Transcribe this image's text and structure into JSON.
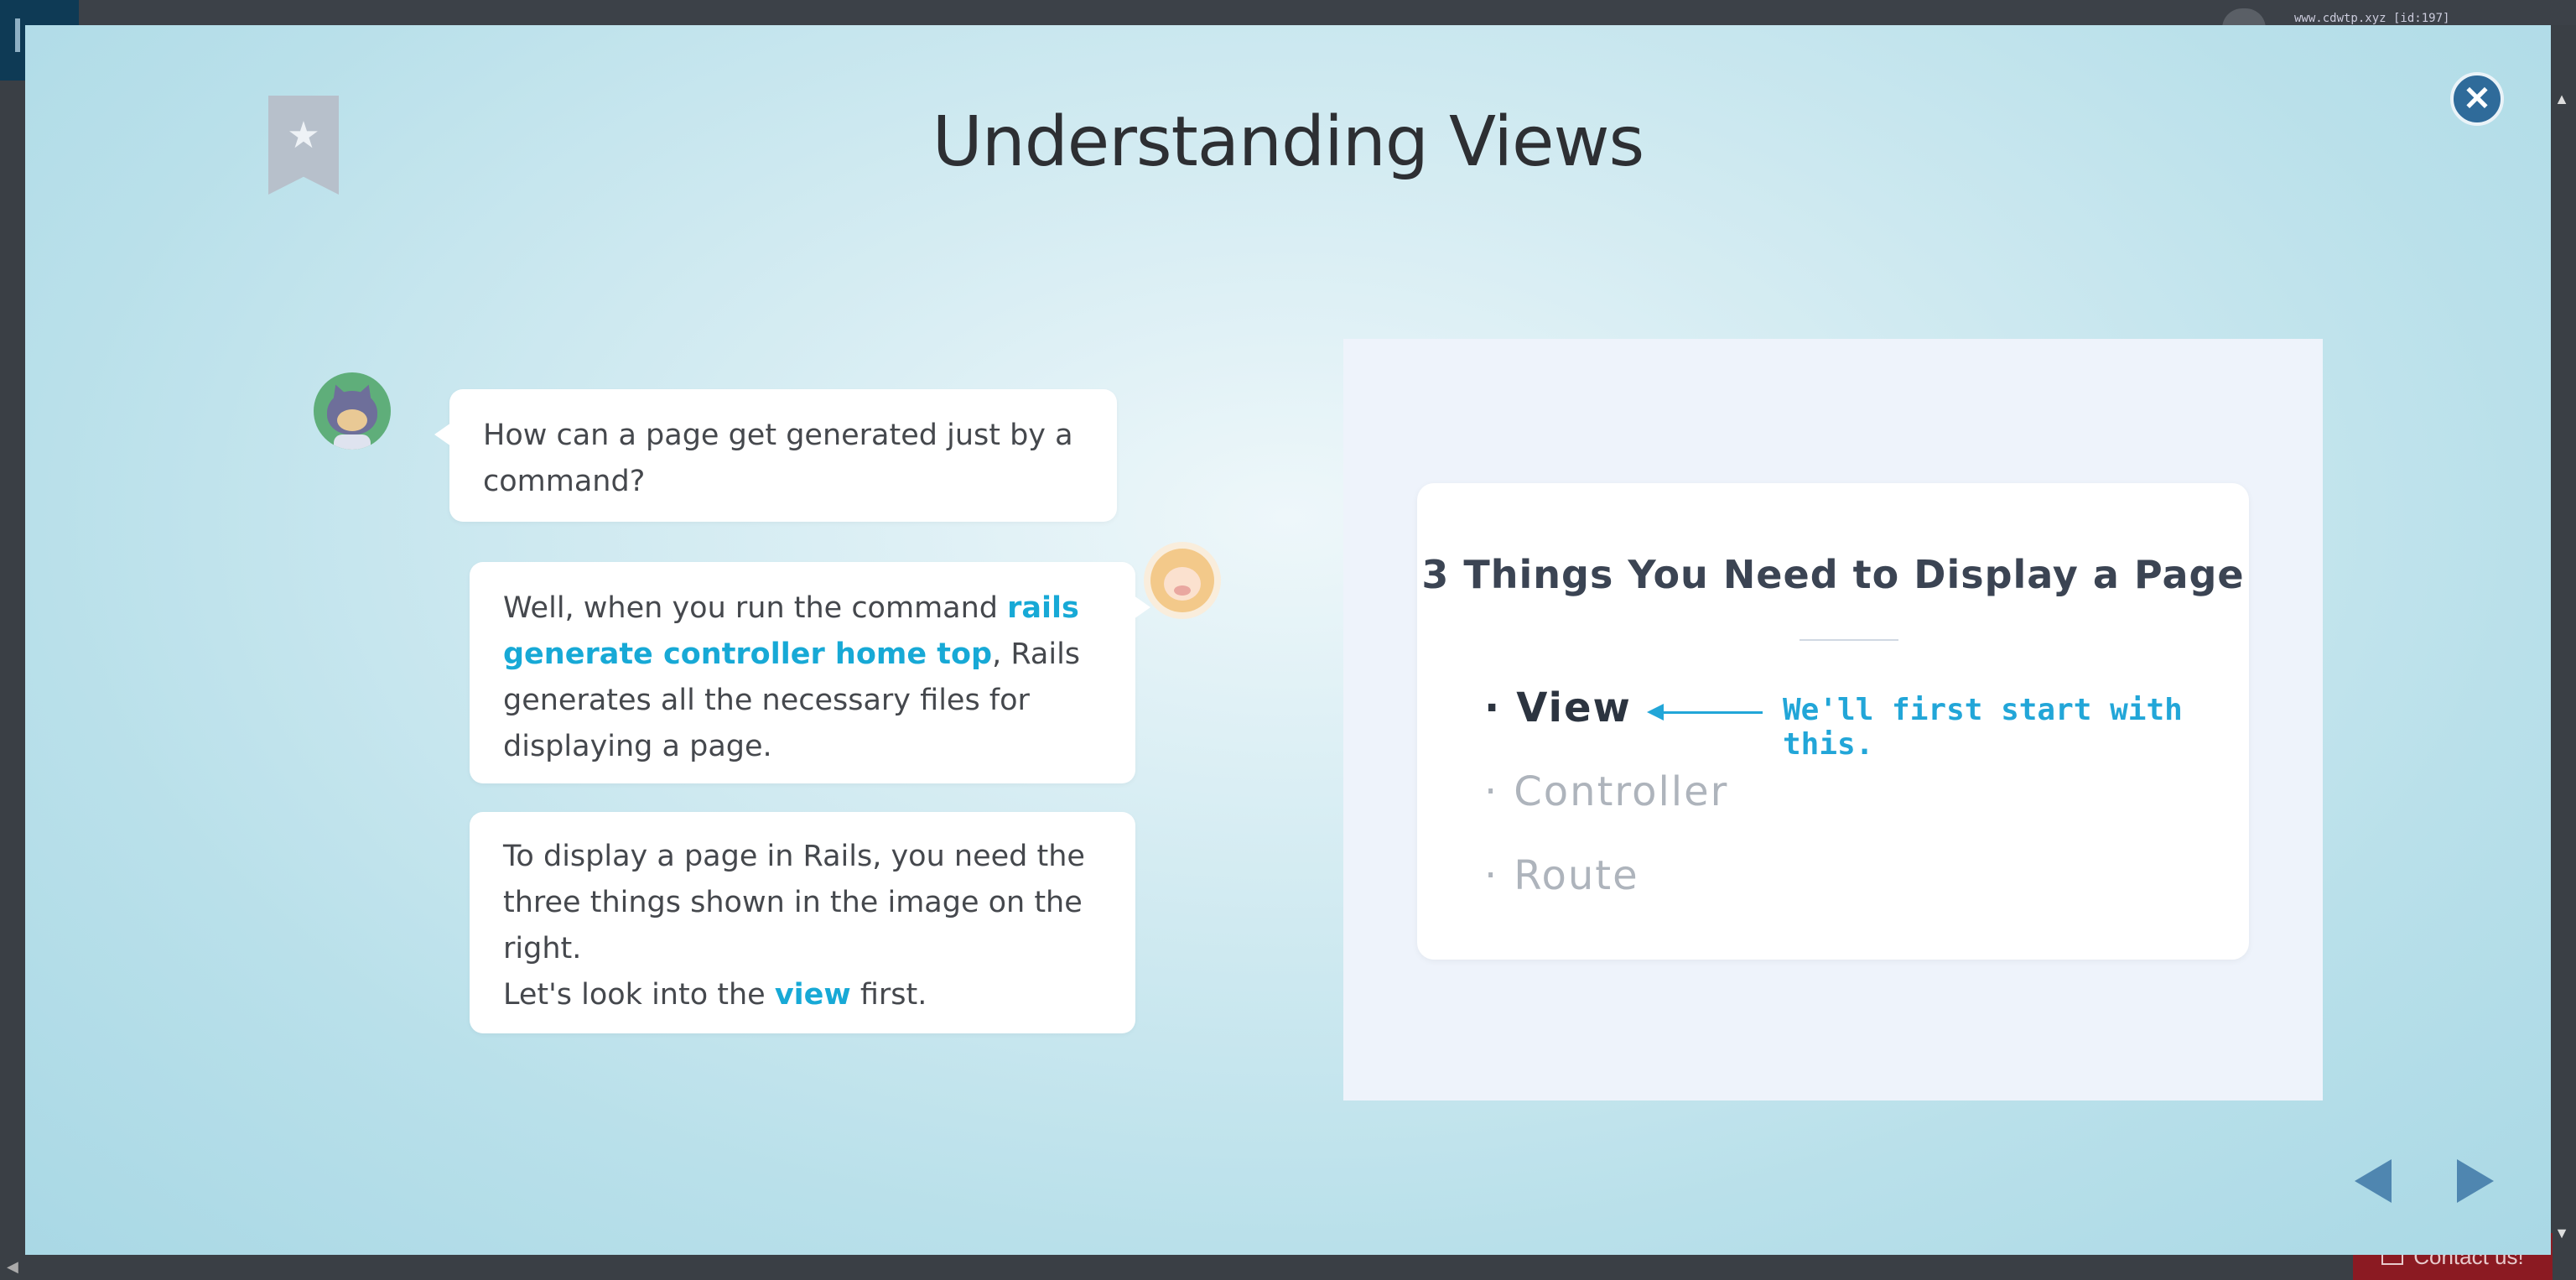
{
  "background": {
    "url_fragment": "www.cdwtp.xyz [id:197]",
    "contact_label": "Contact us!"
  },
  "modal": {
    "title": "Understanding Views",
    "close_icon": "close-icon",
    "bookmark_icon": "star-bookmark-icon"
  },
  "chat": {
    "question_1": "How can a page get generated just by a command?",
    "answer_1": {
      "prefix": "Well, when you run the command ",
      "highlight": "rails generate controller home top",
      "suffix": ", Rails generates all the necessary files for displaying a page."
    },
    "answer_2": {
      "line_1": "To display a page in Rails, you need the three things shown in the image on the right.",
      "line_2_prefix": "Let's look into the ",
      "line_2_highlight": "view",
      "line_2_suffix": " first."
    }
  },
  "slide": {
    "title": "3 Things You Need to Display a Page",
    "items": [
      "View",
      "Controller",
      "Route"
    ],
    "note": "We'll first start with this."
  },
  "navigation": {
    "prev_icon": "prev-triangle-icon",
    "next_icon": "next-triangle-icon"
  },
  "colors": {
    "accent": "#17a9d6",
    "nav": "#4f86b0",
    "close": "#2f6b9a"
  }
}
